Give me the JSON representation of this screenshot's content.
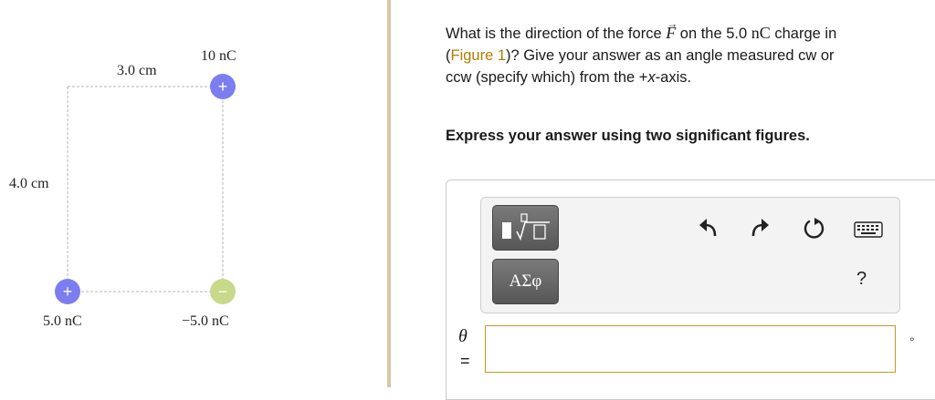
{
  "figure": {
    "width_label": "3.0 cm",
    "height_label": "4.0 cm",
    "charges": [
      {
        "label": "10 nC",
        "sign": "+",
        "color": "#7c7ef0"
      },
      {
        "label": "5.0 nC",
        "sign": "+",
        "color": "#7c7ef0"
      },
      {
        "label": "−5.0 nC",
        "sign": "−",
        "color": "#c7d98a"
      }
    ]
  },
  "question": {
    "part1": "What is the direction of the force ",
    "force_symbol": "F",
    "part2": " on the 5.0 ",
    "unit_nc": "nC",
    "part3": " charge in (",
    "figure_link": "Figure 1",
    "part4": ")? Give your answer as an angle measured cw or ccw (specify which) from the +",
    "axis_x": "x",
    "part5": "-axis."
  },
  "instruction": "Express your answer using two significant figures.",
  "toolbar": {
    "symbols_label": "ΑΣφ",
    "help_label": "?"
  },
  "answer": {
    "variable": "θ",
    "equals": "=",
    "value": "",
    "unit": "°"
  },
  "colors": {
    "positive_charge": "#7c7ef0",
    "negative_charge": "#c7d98a",
    "link": "#b07d00",
    "input_border": "#c39a25"
  },
  "icons": [
    "templates-icon",
    "undo-icon",
    "redo-icon",
    "reset-icon",
    "keyboard-icon"
  ]
}
